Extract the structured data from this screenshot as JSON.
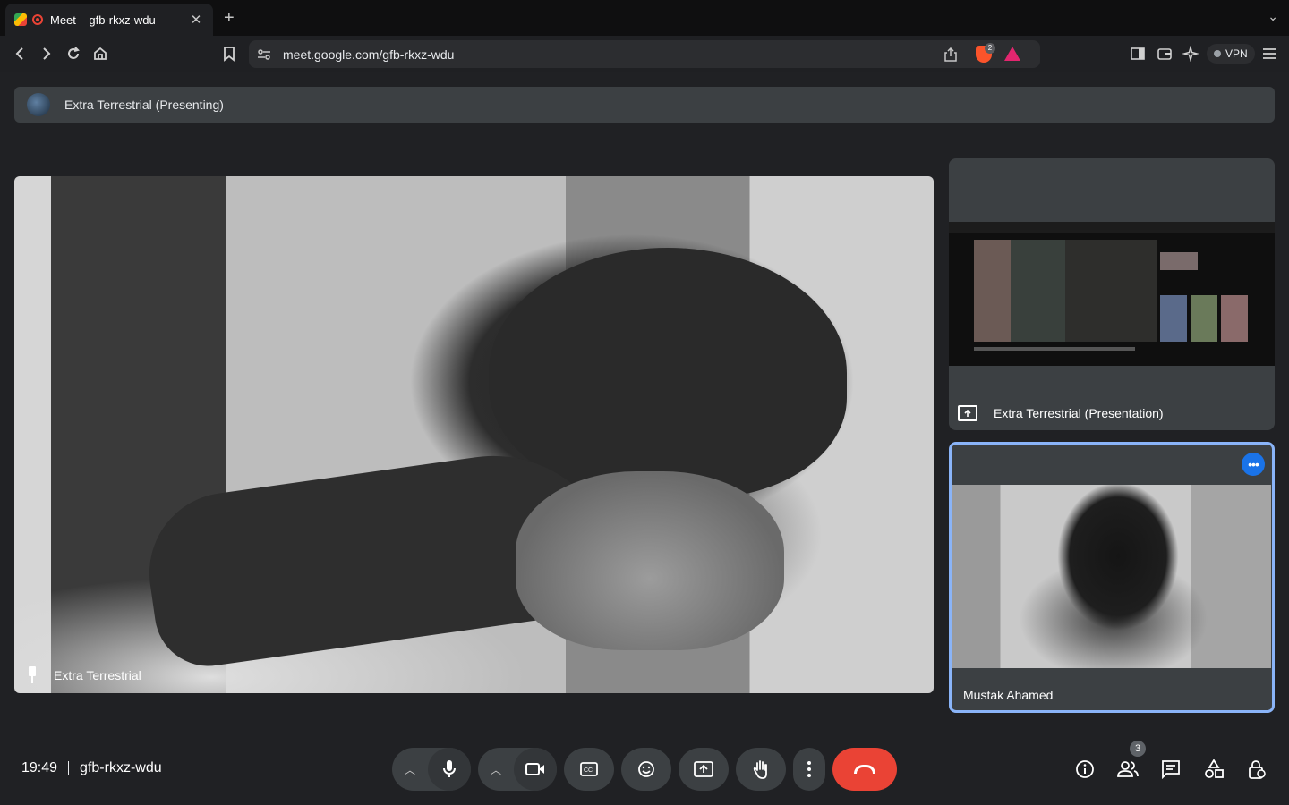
{
  "browser": {
    "tab_title": "Meet – gfb-rkxz-wdu",
    "url": "meet.google.com/gfb-rkxz-wdu",
    "brave_badge_count": "2",
    "vpn_label": "VPN"
  },
  "meet": {
    "presenting_banner": "Extra Terrestrial (Presenting)",
    "main_participant": "Extra Terrestrial",
    "presentation_label": "Extra Terrestrial (Presentation)",
    "self_participant": "Mustak Ahamed",
    "time": "19:49",
    "meeting_code": "gfb-rkxz-wdu",
    "participant_count": "3"
  },
  "icons": {
    "mic": "microphone-icon",
    "camera": "camera-icon",
    "captions": "captions-icon",
    "reactions": "emoji-icon",
    "present": "present-screen-icon",
    "raise_hand": "hand-icon",
    "more": "more-vertical-icon",
    "end_call": "end-call-icon",
    "info": "info-icon",
    "people": "people-icon",
    "chat": "chat-icon",
    "activities": "activities-icon",
    "host_controls": "host-controls-icon"
  },
  "colors": {
    "background": "#202124",
    "tile": "#3c4043",
    "end_call": "#ea4335",
    "active_border": "#8ab4f8",
    "accent": "#1a73e8"
  }
}
